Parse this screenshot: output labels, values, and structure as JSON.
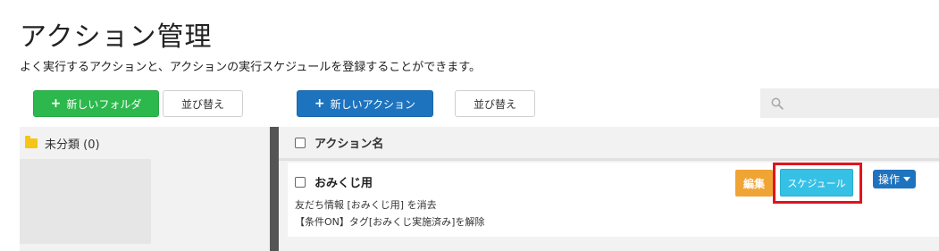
{
  "page": {
    "title": "アクション管理",
    "subtitle": "よく実行するアクションと、アクションの実行スケジュールを登録することができます。"
  },
  "toolbar": {
    "new_folder_label": "新しいフォルダ",
    "sort_label_left": "並び替え",
    "new_action_label": "新しいアクション",
    "sort_label_right": "並び替え",
    "search_placeholder": ""
  },
  "sidebar": {
    "folders": [
      {
        "label": "未分類 (0)",
        "icon": "folder-icon"
      }
    ]
  },
  "table": {
    "header": "アクション名",
    "rows": [
      {
        "name": "おみくじ用",
        "line1": "友だち情報 [おみくじ用] を消去",
        "line2": "【条件ON】タグ[おみくじ実施済み]を解除",
        "edit_label": "編集",
        "schedule_label": "スケジュール",
        "ops_label": "操作"
      }
    ]
  },
  "colors": {
    "green": "#2db84d",
    "blue": "#1e73be",
    "orange": "#f0a436",
    "cyan": "#35c1e6",
    "highlight": "#e0141e"
  }
}
